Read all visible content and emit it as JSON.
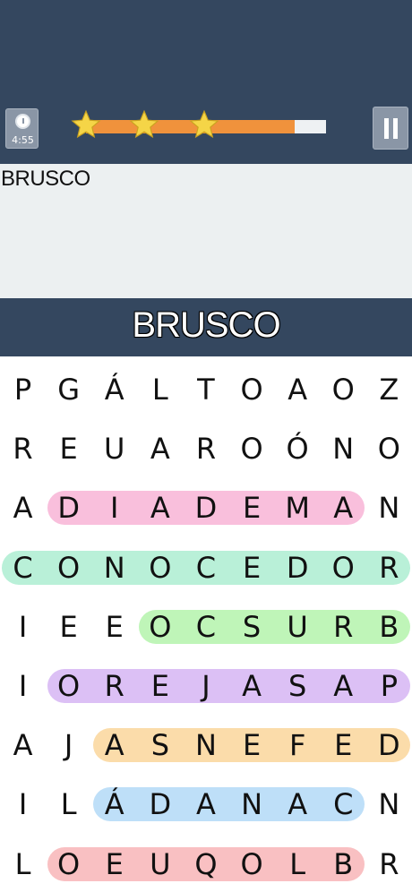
{
  "topbar": {
    "timer": "4:55",
    "progress": 0.87,
    "stars": 3
  },
  "found_word": "BRUSCO",
  "current_word": "BRUSCO",
  "colors": {
    "bar": "#34475f",
    "progress": "#f0923c",
    "star": "#f5d547"
  },
  "grid": [
    [
      "P",
      "G",
      "Á",
      "L",
      "T",
      "O",
      "A",
      "O",
      "Z"
    ],
    [
      "R",
      "E",
      "U",
      "A",
      "R",
      "O",
      "Ó",
      "N",
      "O"
    ],
    [
      "A",
      "D",
      "I",
      "A",
      "D",
      "E",
      "M",
      "A",
      "N"
    ],
    [
      "C",
      "O",
      "N",
      "O",
      "C",
      "E",
      "D",
      "O",
      "R"
    ],
    [
      "I",
      "E",
      "E",
      "O",
      "C",
      "S",
      "U",
      "R",
      "B"
    ],
    [
      "I",
      "O",
      "R",
      "E",
      "J",
      "A",
      "S",
      "A",
      "P"
    ],
    [
      "A",
      "J",
      "A",
      "S",
      "N",
      "E",
      "F",
      "E",
      "D"
    ],
    [
      "I",
      "L",
      "Á",
      "D",
      "A",
      "N",
      "A",
      "C",
      "N"
    ],
    [
      "L",
      "O",
      "E",
      "U",
      "Q",
      "O",
      "L",
      "B",
      "R"
    ]
  ],
  "highlights": [
    {
      "row": 2,
      "from": 1,
      "to": 7,
      "color": "#f9bfdc"
    },
    {
      "row": 3,
      "from": 0,
      "to": 8,
      "color": "#b9f0d8"
    },
    {
      "row": 4,
      "from": 3,
      "to": 8,
      "color": "#bff5b8"
    },
    {
      "row": 5,
      "from": 1,
      "to": 8,
      "color": "#dcc0f5"
    },
    {
      "row": 6,
      "from": 2,
      "to": 8,
      "color": "#fbdcaa"
    },
    {
      "row": 7,
      "from": 2,
      "to": 7,
      "color": "#bedff8"
    },
    {
      "row": 8,
      "from": 1,
      "to": 7,
      "color": "#f9c0c2"
    }
  ]
}
